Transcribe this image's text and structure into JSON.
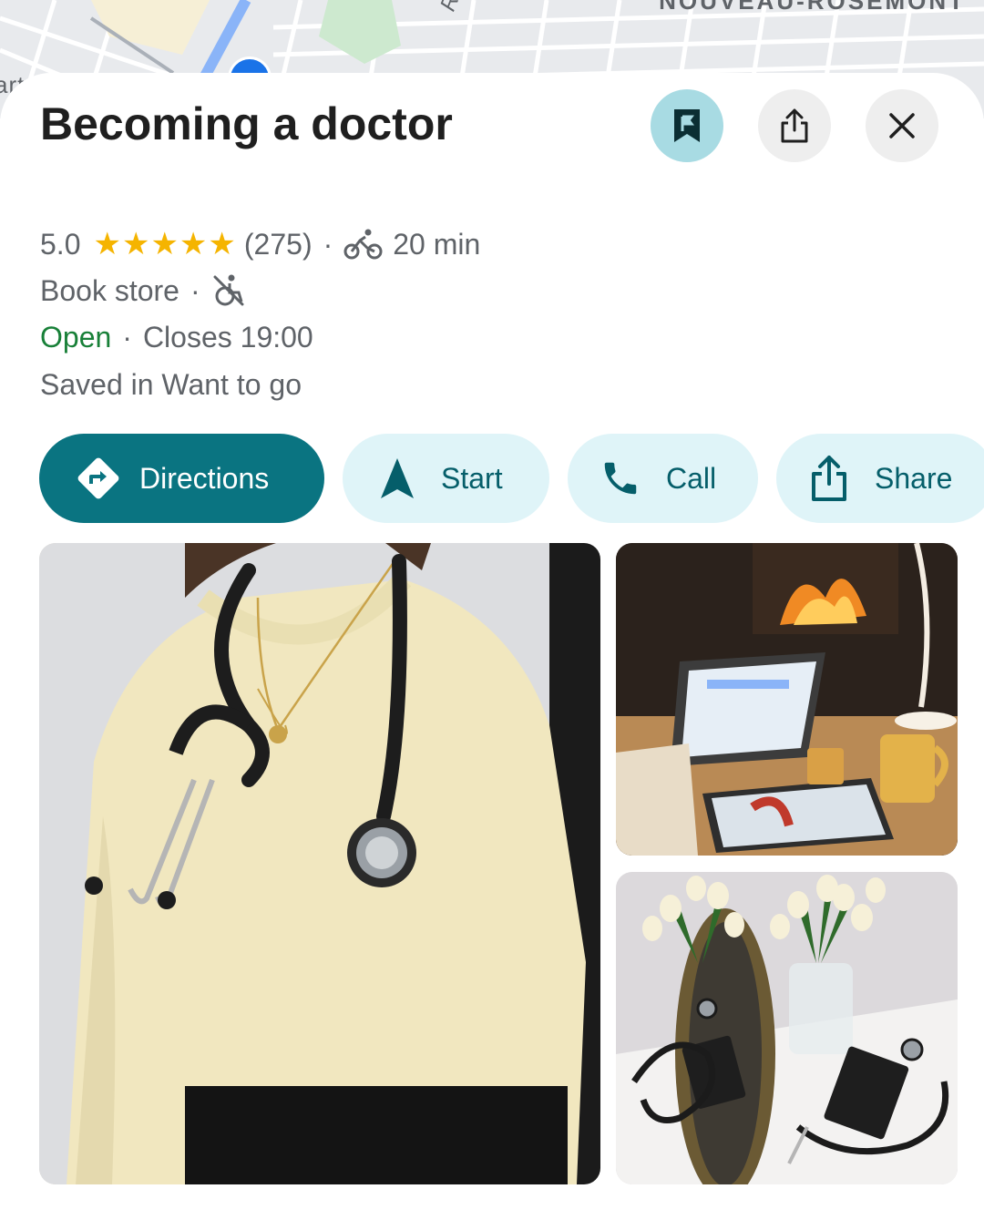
{
  "map": {
    "neighborhood_label": "NOUVEAU-ROSEMONT",
    "street_label": "Rue Je",
    "edge_label": "art"
  },
  "place": {
    "title": "Becoming a doctor",
    "rating": "5.0",
    "stars": 5,
    "stars_text": "★★★★★",
    "review_count": "(275)",
    "separator": "·",
    "travel_time": "20 min",
    "category": "Book store",
    "status": "Open",
    "closing": "Closes 19:00",
    "saved_text": "Saved in Want to go"
  },
  "header_buttons": {
    "save_icon": "bookmark-icon",
    "share_icon": "share-icon",
    "close_icon": "close-icon"
  },
  "actions": [
    {
      "label": "Directions",
      "icon": "directions-icon"
    },
    {
      "label": "Start",
      "icon": "navigation-arrow-icon"
    },
    {
      "label": "Call",
      "icon": "phone-icon"
    },
    {
      "label": "Share",
      "icon": "share-icon"
    }
  ],
  "colors": {
    "accent": "#0a7481",
    "chip_bg": "#dff4f8",
    "chip_text": "#055e6a",
    "save_button_bg": "#a8dbe3",
    "open_green": "#188038",
    "star_gold": "#f5b400"
  },
  "photos": [
    {
      "subject": "person in yellow sweater wearing stethoscope"
    },
    {
      "subject": "laptop and tablet by fireplace with mug"
    },
    {
      "subject": "stethoscopes, notebooks, tulips and mirror on table"
    }
  ]
}
